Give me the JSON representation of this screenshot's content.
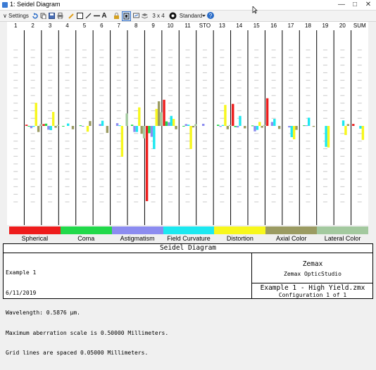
{
  "window": {
    "title": "1: Seidel Diagram",
    "minimize": "—",
    "maximize": "□",
    "close": "✕"
  },
  "toolbar": {
    "settings_label": "Settings",
    "layout_label": "3 x 4",
    "standard_label": "Standard"
  },
  "columns": [
    "1",
    "2",
    "3",
    "4",
    "5",
    "6",
    "7",
    "8",
    "9",
    "10",
    "11",
    "STO",
    "13",
    "14",
    "15",
    "16",
    "17",
    "18",
    "19",
    "20",
    "SUM"
  ],
  "legend": {
    "items": [
      {
        "label": "Spherical",
        "color": "#ee1c1c"
      },
      {
        "label": "Coma",
        "color": "#21d94a"
      },
      {
        "label": "Astigmatism",
        "color": "#8c8cf0"
      },
      {
        "label": "Field Curvature",
        "color": "#1ce8f0"
      },
      {
        "label": "Distortion",
        "color": "#f7f71c"
      },
      {
        "label": "Axial Color",
        "color": "#9b9b62"
      },
      {
        "label": "Lateral Color",
        "color": "#a3c99f"
      }
    ]
  },
  "chart_data": {
    "type": "bar",
    "categories": [
      "1",
      "2",
      "3",
      "4",
      "5",
      "6",
      "7",
      "8",
      "9",
      "10",
      "11",
      "STO",
      "13",
      "14",
      "15",
      "16",
      "17",
      "18",
      "19",
      "20",
      "SUM"
    ],
    "series_names": [
      "Spherical",
      "Coma",
      "Astigmatism",
      "Field Curvature",
      "Distortion",
      "Axial Color",
      "Lateral Color"
    ],
    "unit": "Millimeters",
    "max_scale": 0.5,
    "grid_spacing": 0.05,
    "series": [
      {
        "name": "Spherical",
        "values": [
          0,
          0.008,
          0.012,
          0,
          0,
          0,
          0,
          0,
          -0.495,
          0.172,
          0,
          0,
          0,
          0.145,
          0,
          0.182,
          0,
          0,
          0,
          0,
          0.013
        ]
      },
      {
        "name": "Coma",
        "values": [
          0,
          -0.004,
          0.015,
          -0.002,
          0.004,
          0,
          0,
          0.008,
          -0.048,
          0.03,
          -0.004,
          0,
          0.008,
          -0.008,
          0.003,
          0,
          0,
          0.004,
          0,
          0,
          0
        ]
      },
      {
        "name": "Astigmatism",
        "values": [
          0,
          -0.015,
          -0.025,
          0,
          -0.004,
          0.012,
          0.018,
          -0.04,
          -0.072,
          0.024,
          0.012,
          0.014,
          -0.006,
          -0.01,
          -0.036,
          0.026,
          -0.01,
          0.004,
          0,
          0,
          0
        ]
      },
      {
        "name": "Field Curvature",
        "values": [
          0,
          -0.006,
          -0.028,
          0.016,
          0,
          0.034,
          0.004,
          -0.04,
          -0.152,
          0.066,
          0.008,
          0,
          0.006,
          0.066,
          -0.026,
          0.046,
          -0.074,
          0.054,
          -0.138,
          0.036,
          -0.018
        ]
      },
      {
        "name": "Distortion",
        "values": [
          0,
          0.152,
          0.092,
          0,
          -0.038,
          0,
          -0.203,
          0.122,
          0.112,
          0.046,
          -0.152,
          0,
          0.138,
          0,
          0.026,
          0,
          -0.088,
          0,
          -0.142,
          -0.06,
          -0.092
        ]
      },
      {
        "name": "Axial Color",
        "values": [
          0,
          -0.04,
          -0.012,
          -0.022,
          0.032,
          -0.046,
          0,
          -0.052,
          0.162,
          -0.022,
          -0.01,
          0,
          -0.022,
          -0.016,
          -0.012,
          -0.02,
          -0.026,
          -0.006,
          0,
          0.012,
          0
        ]
      },
      {
        "name": "Lateral Color",
        "values": [
          0,
          0.011,
          0.006,
          0,
          0,
          0,
          0.082,
          -0.082,
          0.09,
          0,
          0.011,
          0,
          0.006,
          0,
          0.006,
          0,
          0,
          0,
          0,
          0,
          0
        ]
      }
    ]
  },
  "info": {
    "header": "Seidel Diagram",
    "lines": [
      "Example 1",
      "6/11/2019",
      "Wavelength: 0.5876 µm.",
      "Maximum aberration scale is 0.50000 Millimeters.",
      "Grid lines are spaced 0.05000 Millimeters."
    ],
    "company": "Zemax",
    "product": "Zemax OpticStudio",
    "file": "Example 1 - High Yield.zmx",
    "config": "Configuration 1 of 1"
  },
  "colors": {
    "grid": "#c8c8c8",
    "axis": "#000000"
  }
}
